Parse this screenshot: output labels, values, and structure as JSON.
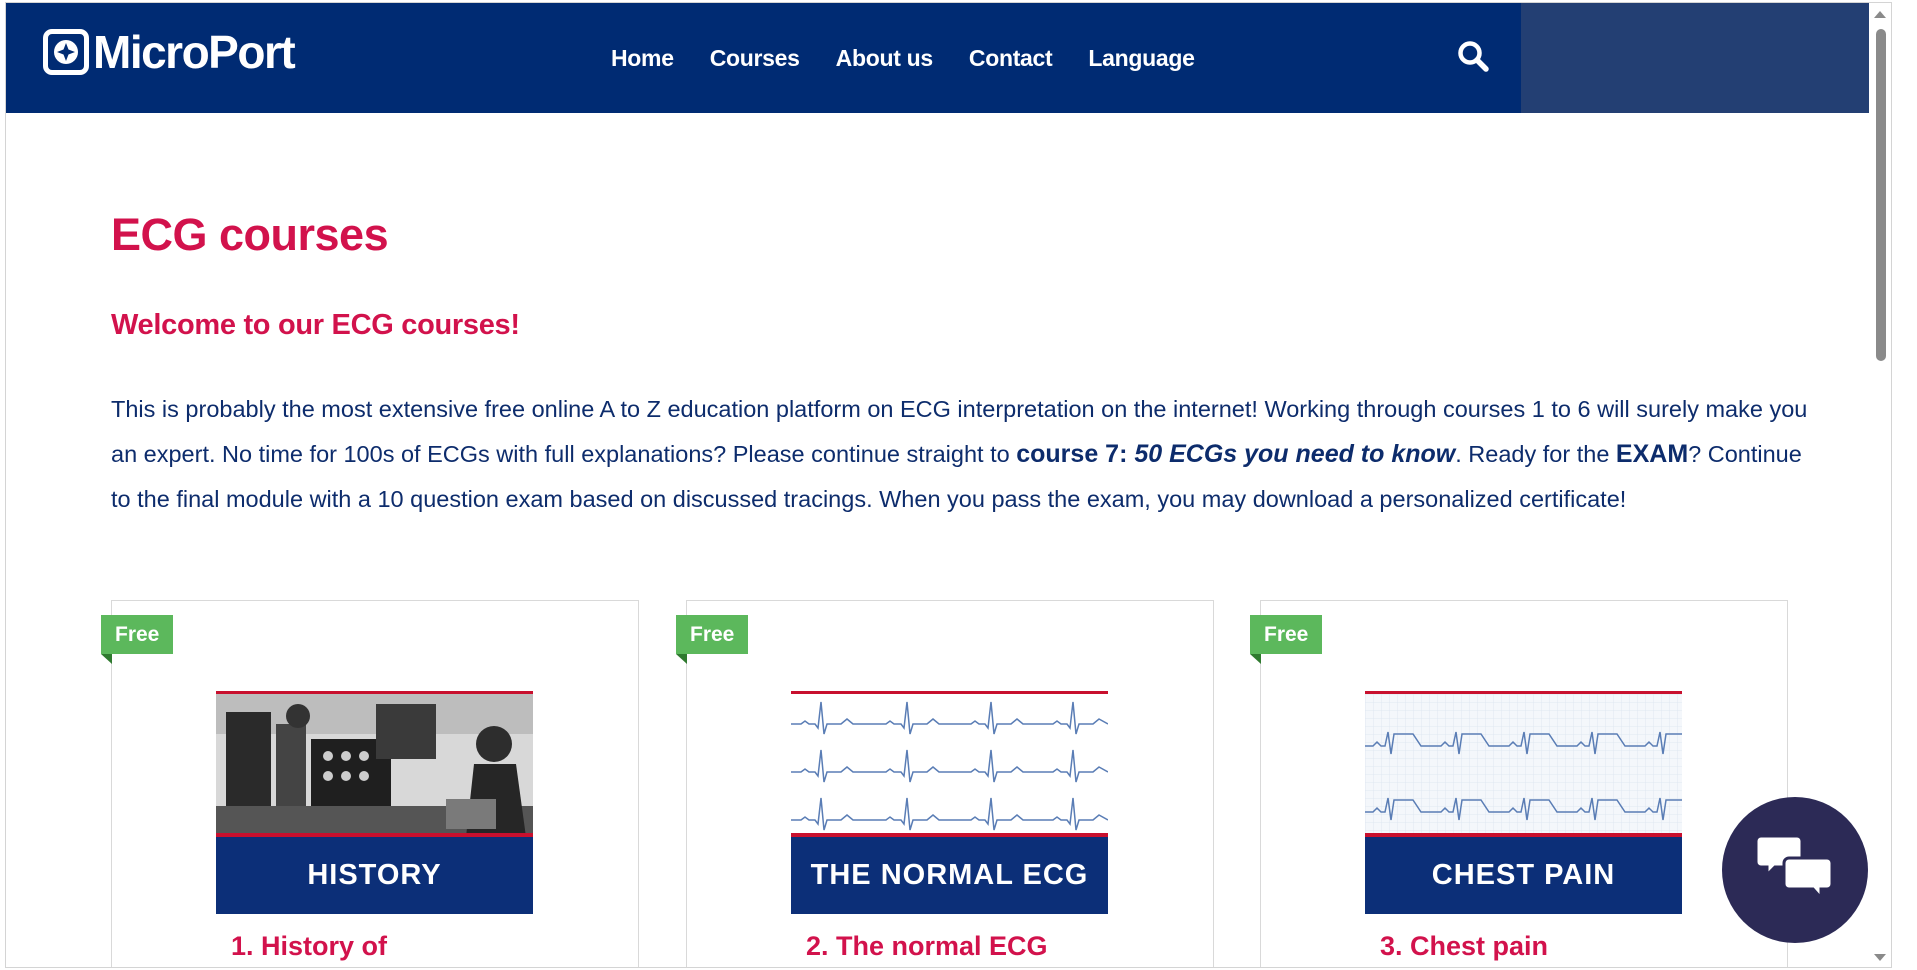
{
  "header": {
    "logo_text": "MicroPort",
    "nav": [
      "Home",
      "Courses",
      "About us",
      "Contact",
      "Language"
    ],
    "search_icon": "search-icon"
  },
  "main": {
    "title": "ECG courses",
    "welcome": "Welcome to our ECG courses!",
    "intro_part1": "This is probably the most extensive free online A to Z education platform on ECG interpretation on the internet! Working through courses 1 to 6 will surely make you an expert. No time for 100s of ECGs with full explanations? Please continue straight to ",
    "intro_course7": "course 7: ",
    "intro_course7_name": "50 ECGs you need to know",
    "intro_part2": ". Ready for the ",
    "intro_exam": "EXAM",
    "intro_part3": "? Continue to the final module with a 10 question exam based on discussed tracings. When you pass the exam, you may download a personalized certificate!"
  },
  "courses": [
    {
      "badge": "Free",
      "thumb_label": "HISTORY",
      "title": "1. History of"
    },
    {
      "badge": "Free",
      "thumb_label": "THE NORMAL ECG",
      "title": "2. The normal ECG"
    },
    {
      "badge": "Free",
      "thumb_label": "CHEST PAIN",
      "title": "3. Chest pain"
    }
  ],
  "colors": {
    "header_bg": "#002b73",
    "accent_red": "#d2124c",
    "badge_green": "#5cb85c",
    "chat_bg": "#2c2a56"
  },
  "chat_icon": "chat-bubbles-icon"
}
